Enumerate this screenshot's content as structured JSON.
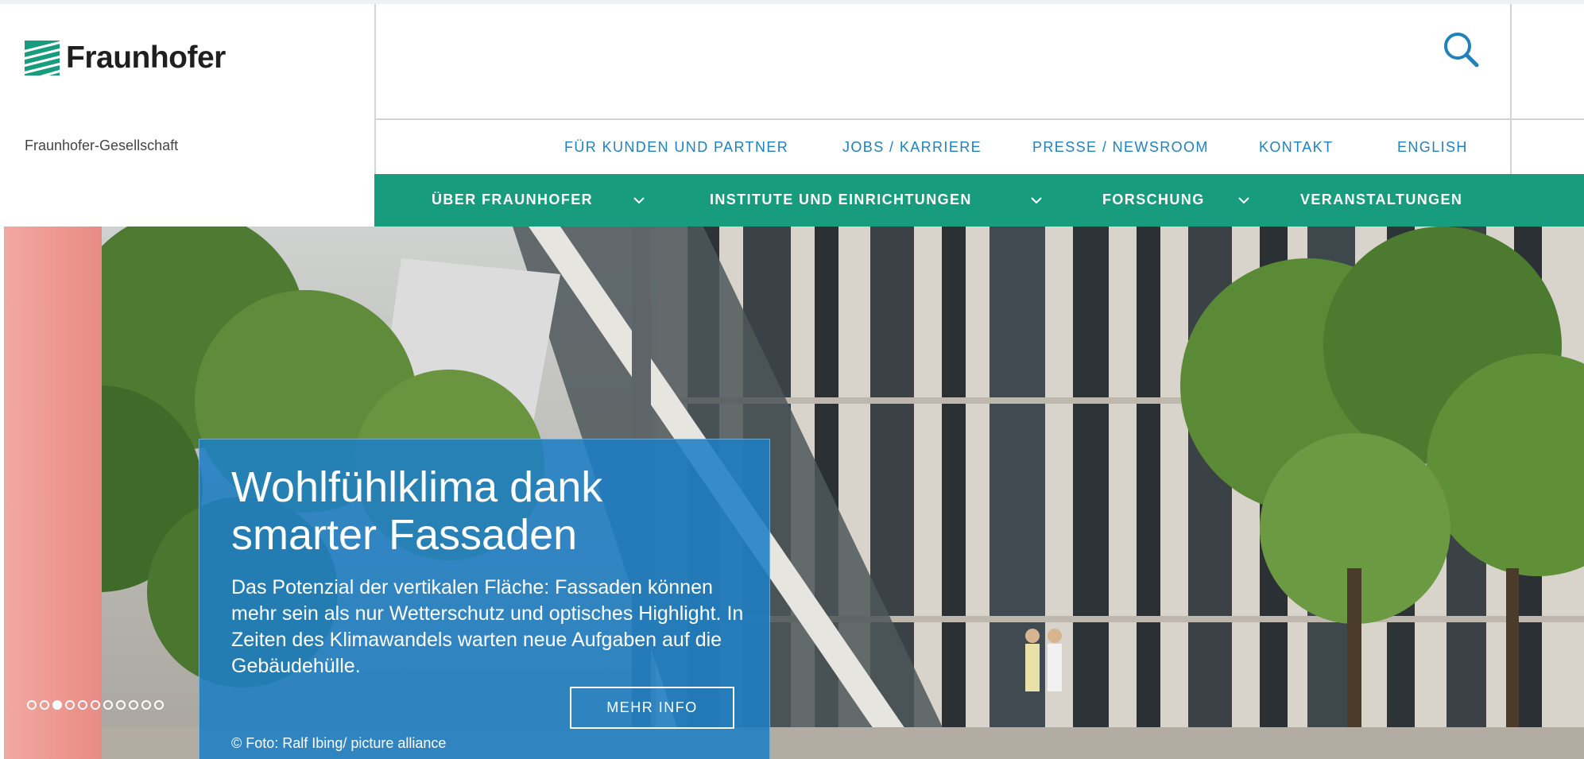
{
  "header": {
    "logo_text": "Fraunhofer",
    "org_name": "Fraunhofer-Gesellschaft",
    "search_icon": "search-icon"
  },
  "meta_nav": [
    {
      "label": "FÜR KUNDEN UND PARTNER"
    },
    {
      "label": "JOBS / KARRIERE"
    },
    {
      "label": "PRESSE / NEWSROOM"
    },
    {
      "label": "KONTAKT"
    },
    {
      "label": "ENGLISH"
    }
  ],
  "main_nav": [
    {
      "label": "ÜBER FRAUNHOFER",
      "dropdown": true
    },
    {
      "label": "INSTITUTE UND EINRICHTUNGEN",
      "dropdown": true
    },
    {
      "label": "FORSCHUNG",
      "dropdown": true
    },
    {
      "label": "VERANSTALTUNGEN",
      "dropdown": false
    }
  ],
  "hero": {
    "title": "Wohlfühlklima dank smarter Fassaden",
    "text": "Das Potenzial der vertikalen Fläche: Fassaden können mehr sein als nur Wetterschutz und optisches Highlight. In Zeiten des Klimawandels warten neue Aufgaben auf die Gebäudehülle.",
    "button_label": "MEHR INFO",
    "credit": "© Foto: Ralf Ibing/ picture alliance",
    "slide_count": 11,
    "active_slide": 3
  },
  "colors": {
    "brand_green": "#179c7d",
    "link_blue": "#1f82c0",
    "teaser_blue": "#1e7ec4"
  }
}
